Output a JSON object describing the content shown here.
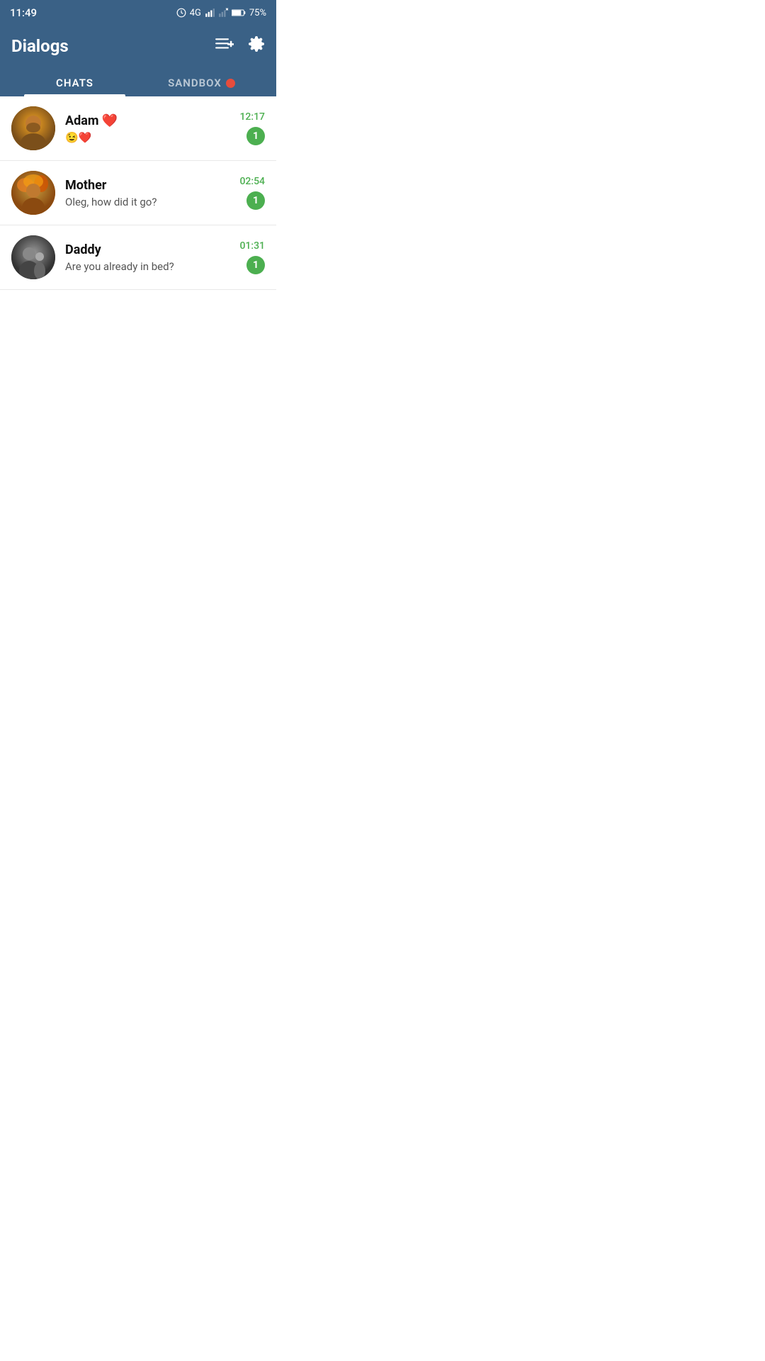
{
  "statusBar": {
    "time": "11:49",
    "signal": "4G",
    "battery": "75%"
  },
  "header": {
    "title": "Dialogs",
    "newChatIcon": "≡+",
    "settingsIcon": "⚙"
  },
  "tabs": [
    {
      "id": "chats",
      "label": "CHATS",
      "active": true
    },
    {
      "id": "sandbox",
      "label": "SANDBOX",
      "active": false
    }
  ],
  "chats": [
    {
      "id": 1,
      "name": "Adam ❤️",
      "nameEmoji": "❤️",
      "preview": "😉❤️",
      "time": "12:17",
      "unread": 1,
      "avatarType": "adam"
    },
    {
      "id": 2,
      "name": "Mother",
      "preview": "Oleg, how did it go?",
      "time": "02:54",
      "unread": 1,
      "avatarType": "mother"
    },
    {
      "id": 3,
      "name": "Daddy",
      "preview": "Are you already in bed?",
      "time": "01:31",
      "unread": 1,
      "avatarType": "daddy"
    }
  ],
  "icons": {
    "newChat": "≡+",
    "settings": "⚙"
  }
}
